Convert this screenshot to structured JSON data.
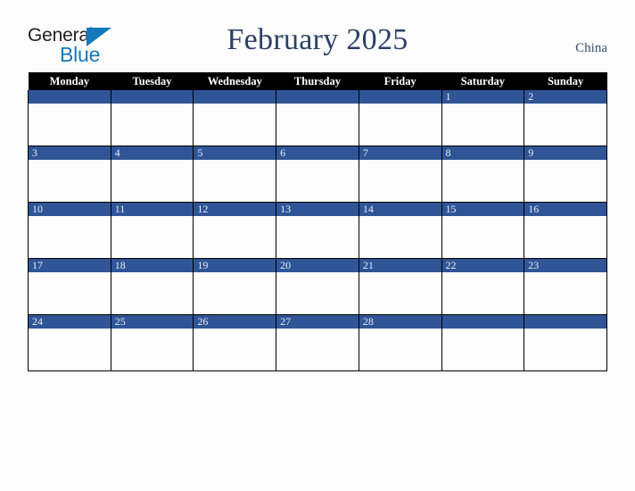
{
  "brand": {
    "name_part1": "General",
    "name_part2": "Blue",
    "triangle_color": "#1479bd",
    "text_color": "#231f20"
  },
  "header": {
    "title": "February 2025",
    "country": "China",
    "title_color": "#2b3f66"
  },
  "calendar": {
    "month": "February",
    "year": "2025",
    "week_start": "Monday",
    "header_bg": "#000000",
    "header_text_color": "#ffffff",
    "day_band_color": "#2f5597",
    "day_number_color": "#e8ecf4",
    "weekdays": [
      "Monday",
      "Tuesday",
      "Wednesday",
      "Thursday",
      "Friday",
      "Saturday",
      "Sunday"
    ],
    "weeks": [
      [
        "",
        "",
        "",
        "",
        "",
        "1",
        "2"
      ],
      [
        "3",
        "4",
        "5",
        "6",
        "7",
        "8",
        "9"
      ],
      [
        "10",
        "11",
        "12",
        "13",
        "14",
        "15",
        "16"
      ],
      [
        "17",
        "18",
        "19",
        "20",
        "21",
        "22",
        "23"
      ],
      [
        "24",
        "25",
        "26",
        "27",
        "28",
        "",
        ""
      ]
    ]
  }
}
